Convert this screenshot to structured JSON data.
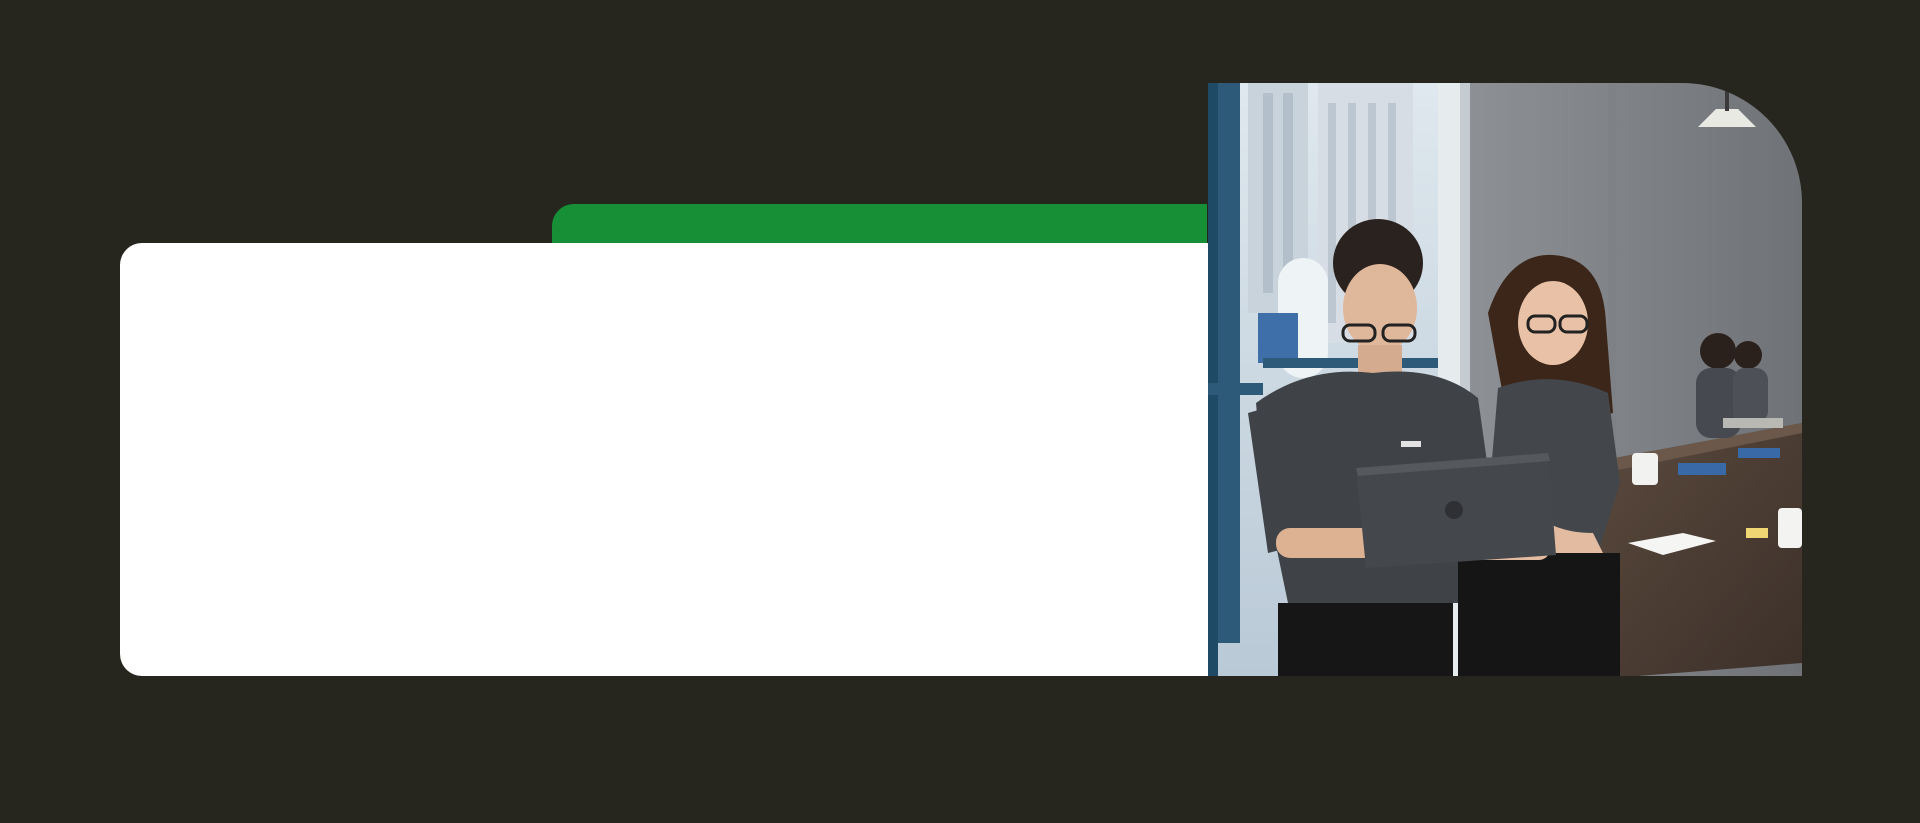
{
  "page": {
    "background_color": "#26261f"
  },
  "accent_tab": {
    "color": "#168f36"
  },
  "content_card": {
    "color": "#ffffff"
  },
  "photo": {
    "subject": "two-people-looking-at-laptop-in-meeting-room"
  }
}
